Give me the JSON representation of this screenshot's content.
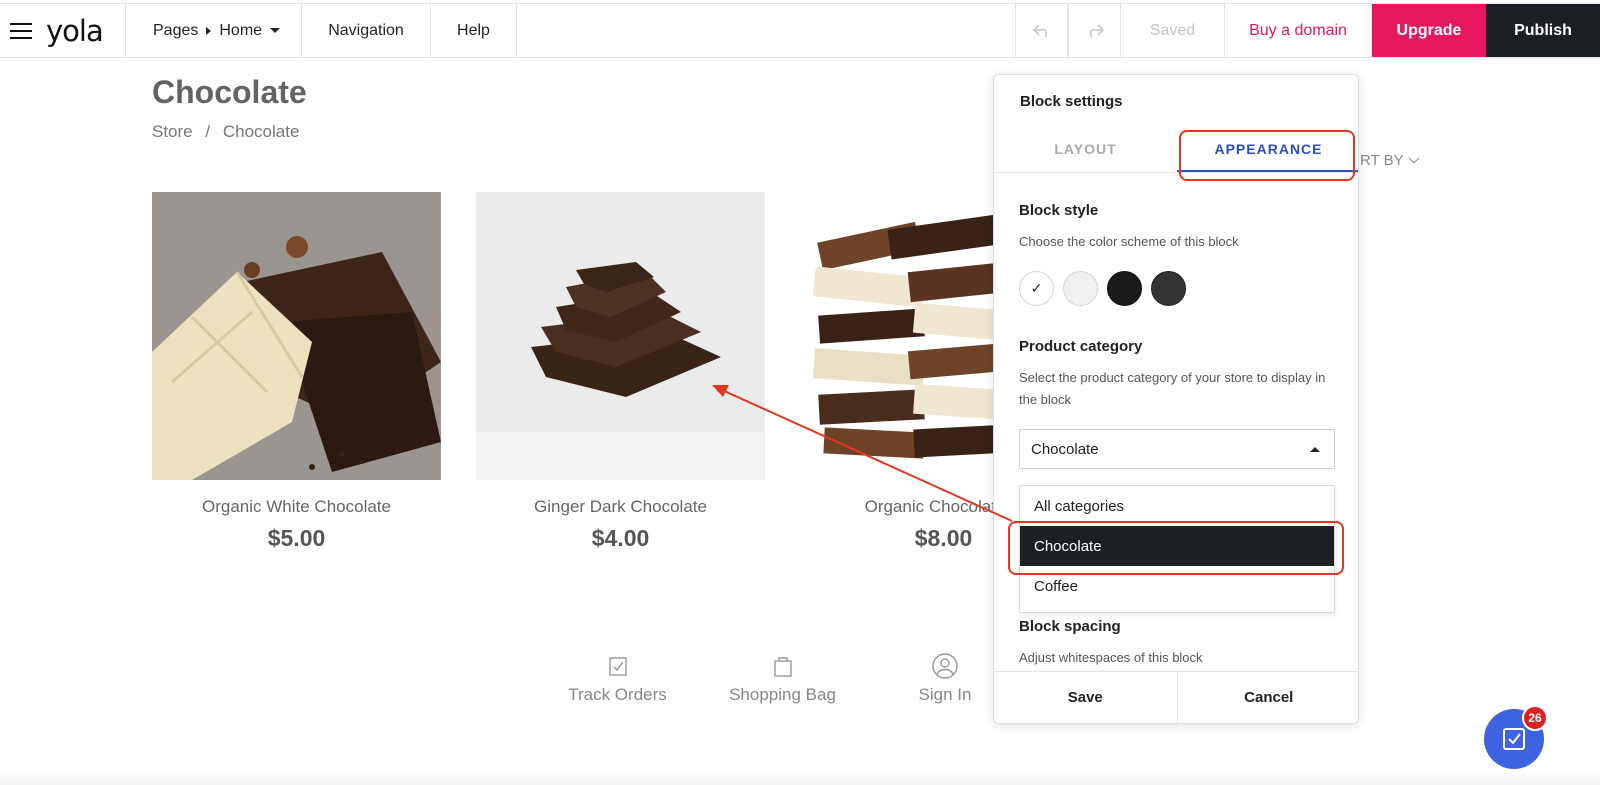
{
  "topbar": {
    "logo": "yola",
    "pages_label": "Pages",
    "current_page": "Home",
    "navigation_label": "Navigation",
    "help_label": "Help",
    "saved_label": "Saved",
    "buy_domain_label": "Buy a domain",
    "upgrade_label": "Upgrade",
    "publish_label": "Publish",
    "colors": {
      "upgrade_bg": "#e5175e",
      "publish_bg": "#1c1f24",
      "domain_text": "#e5175e"
    }
  },
  "page": {
    "title": "Chocolate",
    "breadcrumb": [
      "Store",
      "/",
      "Chocolate"
    ],
    "sort_label": "RT BY"
  },
  "products": [
    {
      "name": "Organic White Chocolate",
      "price": "$5.00"
    },
    {
      "name": "Ginger Dark Chocolate",
      "price": "$4.00"
    },
    {
      "name": "Organic Chocolate C",
      "price": "$8.00"
    }
  ],
  "footer_links": [
    {
      "label": "Track Orders",
      "icon": "track-orders-icon"
    },
    {
      "label": "Shopping Bag",
      "icon": "shopping-bag-icon"
    },
    {
      "label": "Sign In",
      "icon": "user-icon"
    }
  ],
  "panel": {
    "title": "Block settings",
    "tabs": [
      "LAYOUT",
      "APPEARANCE"
    ],
    "active_tab": "APPEARANCE",
    "block_style": {
      "title": "Block style",
      "description": "Choose the color scheme of this block",
      "swatches": [
        "#ffffff",
        "#f1f1f1",
        "#1b1b1b",
        "#333333"
      ],
      "selected_mark": "✓"
    },
    "product_category": {
      "title": "Product category",
      "description": "Select the product category of your store to display in the block",
      "selected": "Chocolate",
      "options": [
        "All categories",
        "Chocolate",
        "Coffee"
      ]
    },
    "block_spacing": {
      "title": "Block spacing",
      "description": "Adjust whitespaces of this block"
    },
    "save_label": "Save",
    "cancel_label": "Cancel"
  },
  "notifications": {
    "count": "26"
  },
  "annotation_color": "#e2371f"
}
